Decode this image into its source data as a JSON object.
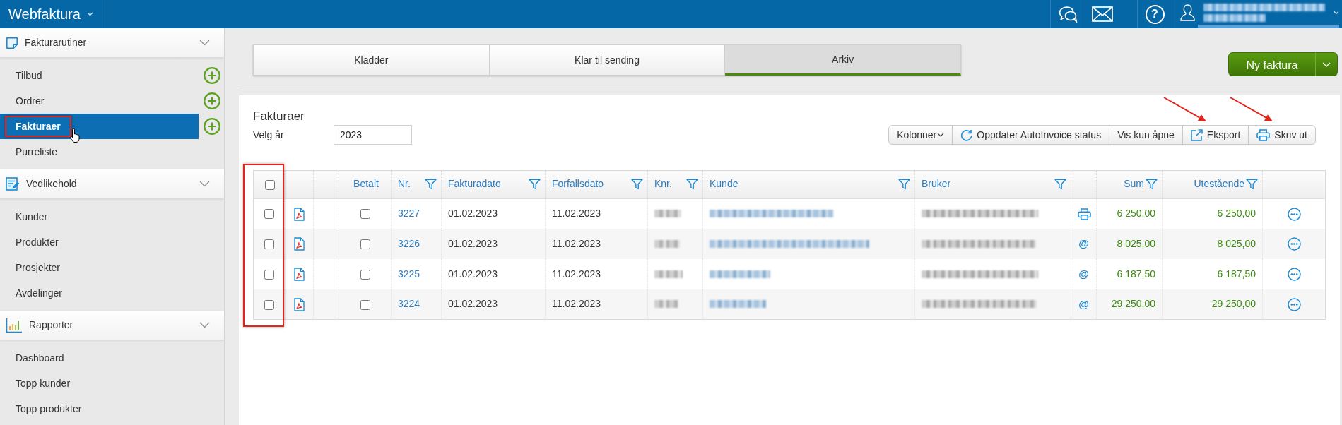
{
  "topbar": {
    "brand": "Webfaktura",
    "help_label": "?"
  },
  "sidebar": {
    "sections": [
      {
        "title": "Fakturarutiner",
        "expanded": true,
        "items": [
          {
            "label": "Tilbud",
            "selected": false,
            "add": true,
            "annotated": false
          },
          {
            "label": "Ordrer",
            "selected": false,
            "add": true,
            "annotated": false
          },
          {
            "label": "Fakturaer",
            "selected": true,
            "add": true,
            "annotated": true
          },
          {
            "label": "Purreliste",
            "selected": false,
            "add": false,
            "annotated": false
          }
        ]
      },
      {
        "title": "Vedlikehold",
        "expanded": true,
        "items": [
          {
            "label": "Kunder",
            "selected": false,
            "add": false,
            "annotated": false
          },
          {
            "label": "Produkter",
            "selected": false,
            "add": false,
            "annotated": false
          },
          {
            "label": "Prosjekter",
            "selected": false,
            "add": false,
            "annotated": false
          },
          {
            "label": "Avdelinger",
            "selected": false,
            "add": false,
            "annotated": false
          }
        ]
      },
      {
        "title": "Rapporter",
        "expanded": true,
        "items": [
          {
            "label": "Dashboard",
            "selected": false,
            "add": false,
            "annotated": false
          },
          {
            "label": "Topp kunder",
            "selected": false,
            "add": false,
            "annotated": false
          },
          {
            "label": "Topp produkter",
            "selected": false,
            "add": false,
            "annotated": false
          }
        ]
      }
    ]
  },
  "tabs": [
    {
      "label": "Kladder",
      "selected": false
    },
    {
      "label": "Klar til sending",
      "selected": false
    },
    {
      "label": "Arkiv",
      "selected": true
    }
  ],
  "new_invoice_button": {
    "label": "Ny faktura"
  },
  "panel": {
    "title": "Fakturaer",
    "year_label": "Velg år",
    "year_value": "2023",
    "toolbar": [
      {
        "kind": "dropdown",
        "label": "Kolonner",
        "annotated": false
      },
      {
        "kind": "refresh",
        "label": "Oppdater AutoInvoice status",
        "annotated": false
      },
      {
        "kind": "plain",
        "label": "Vis kun åpne",
        "annotated": false
      },
      {
        "kind": "export",
        "label": "Eksport",
        "annotated": true
      },
      {
        "kind": "print",
        "label": "Skriv ut",
        "annotated": true
      }
    ]
  },
  "table": {
    "select_column_annotated": true,
    "columns": [
      {
        "kind": "select",
        "checked": false
      },
      {
        "kind": "pdf"
      },
      {
        "kind": "blank"
      },
      {
        "kind": "paid",
        "label": "Betalt",
        "filter": false
      },
      {
        "kind": "number",
        "label": "Nr.",
        "filter": true
      },
      {
        "kind": "invoice_date",
        "label": "Fakturadato",
        "filter": true
      },
      {
        "kind": "due_date",
        "label": "Forfallsdato",
        "filter": true
      },
      {
        "kind": "customer_no",
        "label": "Knr.",
        "filter": true
      },
      {
        "kind": "customer",
        "label": "Kunde",
        "filter": true
      },
      {
        "kind": "user",
        "label": "Bruker",
        "filter": true
      },
      {
        "kind": "delivery"
      },
      {
        "kind": "sum",
        "label": "Sum",
        "filter": true
      },
      {
        "kind": "outstanding",
        "label": "Utestående",
        "filter": true
      },
      {
        "kind": "actions"
      }
    ],
    "rows": [
      {
        "selected": false,
        "paid": false,
        "number": "3227",
        "invoice_date": "01.02.2023",
        "due_date": "11.02.2023",
        "delivery": {
          "kind": "print"
        },
        "sum": "6 250,00",
        "outstanding": "6 250,00"
      },
      {
        "selected": false,
        "paid": false,
        "number": "3226",
        "invoice_date": "01.02.2023",
        "due_date": "11.02.2023",
        "delivery": {
          "kind": "email",
          "text": "@"
        },
        "sum": "8 025,00",
        "outstanding": "8 025,00"
      },
      {
        "selected": false,
        "paid": false,
        "number": "3225",
        "invoice_date": "01.02.2023",
        "due_date": "11.02.2023",
        "delivery": {
          "kind": "email",
          "text": "@"
        },
        "sum": "6 187,50",
        "outstanding": "6 187,50"
      },
      {
        "selected": false,
        "paid": false,
        "number": "3224",
        "invoice_date": "01.02.2023",
        "due_date": "11.02.2023",
        "delivery": {
          "kind": "email",
          "text": "@"
        },
        "sum": "29 250,00",
        "outstanding": "29 250,00"
      }
    ]
  }
}
